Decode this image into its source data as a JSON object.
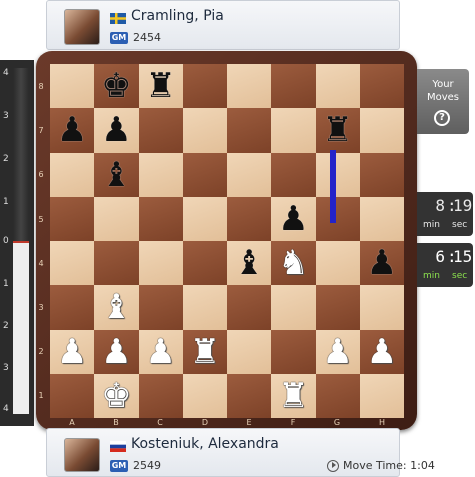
{
  "top_player": {
    "name": "Cramling, Pia",
    "title": "GM",
    "rating": "2454",
    "flag": "sweden"
  },
  "bottom_player": {
    "name": "Kosteniuk, Alexandra",
    "title": "GM",
    "rating": "2549",
    "flag": "russia",
    "move_time_label": "Move Time: 1:04"
  },
  "eval_bar": {
    "labels": [
      "4",
      "3",
      "2",
      "1",
      "0",
      "1",
      "2",
      "3",
      "4"
    ],
    "evaluation": 0
  },
  "your_moves": {
    "line1": "Your",
    "line2": "Moves",
    "help": "?"
  },
  "clocks": {
    "top": {
      "min": "8",
      "sep": ":",
      "sec": "19",
      "min_label": "min",
      "sec_label": "sec"
    },
    "bottom": {
      "min": "6",
      "sep": ":",
      "sec": "15",
      "min_label": "min",
      "sec_label": "sec"
    }
  },
  "board": {
    "files": [
      "A",
      "B",
      "C",
      "D",
      "E",
      "F",
      "G",
      "H"
    ],
    "ranks": [
      "8",
      "7",
      "6",
      "5",
      "4",
      "3",
      "2",
      "1"
    ],
    "last_move": "g5-g7",
    "pieces": [
      {
        "square": "b8",
        "color": "b",
        "type": "king",
        "glyph": "♚"
      },
      {
        "square": "c8",
        "color": "b",
        "type": "rook",
        "glyph": "♜"
      },
      {
        "square": "a7",
        "color": "b",
        "type": "pawn",
        "glyph": "♟"
      },
      {
        "square": "b7",
        "color": "b",
        "type": "pawn",
        "glyph": "♟"
      },
      {
        "square": "g7",
        "color": "b",
        "type": "rook",
        "glyph": "♜"
      },
      {
        "square": "b6",
        "color": "b",
        "type": "bishop",
        "glyph": "♝"
      },
      {
        "square": "f5",
        "color": "b",
        "type": "pawn",
        "glyph": "♟"
      },
      {
        "square": "e4",
        "color": "b",
        "type": "bishop",
        "glyph": "♝"
      },
      {
        "square": "f4",
        "color": "w",
        "type": "knight",
        "glyph": "♞"
      },
      {
        "square": "h4",
        "color": "b",
        "type": "pawn",
        "glyph": "♟"
      },
      {
        "square": "b3",
        "color": "w",
        "type": "bishop",
        "glyph": "♝"
      },
      {
        "square": "a2",
        "color": "w",
        "type": "pawn",
        "glyph": "♟"
      },
      {
        "square": "b2",
        "color": "w",
        "type": "pawn",
        "glyph": "♟"
      },
      {
        "square": "c2",
        "color": "w",
        "type": "pawn",
        "glyph": "♟"
      },
      {
        "square": "d2",
        "color": "w",
        "type": "rook",
        "glyph": "♜"
      },
      {
        "square": "g2",
        "color": "w",
        "type": "pawn",
        "glyph": "♟"
      },
      {
        "square": "h2",
        "color": "w",
        "type": "pawn",
        "glyph": "♟"
      },
      {
        "square": "b1",
        "color": "w",
        "type": "king",
        "glyph": "♚"
      },
      {
        "square": "f1",
        "color": "w",
        "type": "rook",
        "glyph": "♜"
      }
    ]
  }
}
